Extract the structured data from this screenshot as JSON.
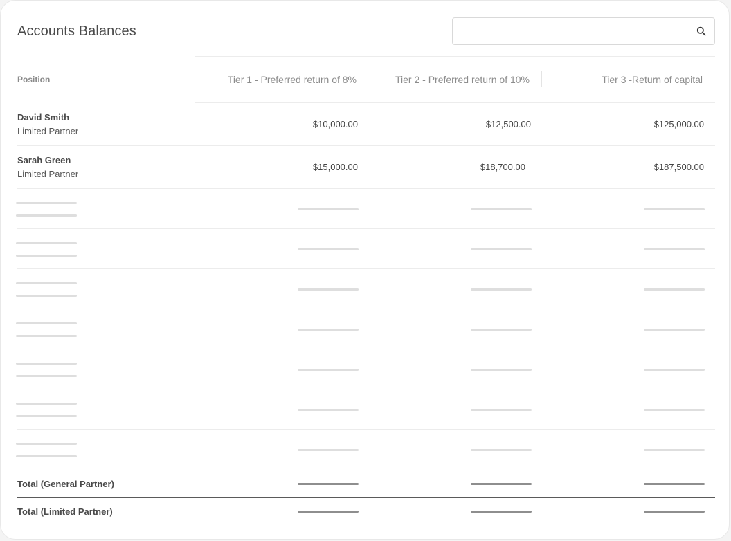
{
  "page": {
    "title": "Accounts Balances"
  },
  "search": {
    "value": "",
    "placeholder": "",
    "icon": "search-icon"
  },
  "table": {
    "columns": [
      "Position",
      "Tier 1 - Preferred return of 8%",
      "Tier 2 - Preferred return of 10%",
      "Tier 3 -Return of capital"
    ],
    "rows": [
      {
        "name": "David Smith",
        "role": "Limited Partner",
        "tier1": "$10,000.00",
        "tier2": "$12,500.00",
        "tier3": "$125,000.00"
      },
      {
        "name": "Sarah Green",
        "role": "Limited Partner",
        "tier1": "$15,000.00",
        "tier2": "$18,700.00",
        "tier3": "$187,500.00"
      }
    ],
    "totals": [
      {
        "label": "Total (General Partner)"
      },
      {
        "label": "Total (Limited Partner)"
      }
    ]
  },
  "colors": {
    "skeleton": "#dedede",
    "skeleton_total": "#8e8e8e",
    "divider": "#ececec",
    "total_border": "#5a5a5a"
  }
}
